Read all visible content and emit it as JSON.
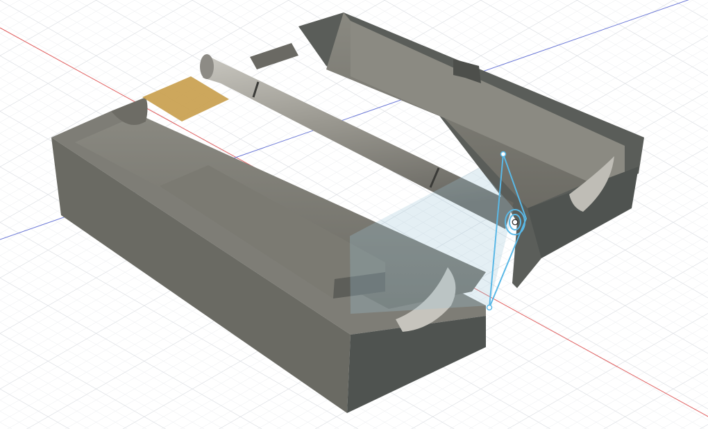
{
  "app": {
    "name": "3D CAD viewport",
    "view": "isometric"
  },
  "viewport": {
    "background": "#ffffff",
    "grid_minor_color": "#e9ebee",
    "grid_major_color": "#d6d9de",
    "axis_x_color": "#e06060",
    "axis_y_color": "#6b78d6"
  },
  "model": {
    "body_color": "#7b7a72",
    "dark_wall_color": "#4f5350",
    "highlight_face_color": "#c9a04e",
    "rod_color": "#a09e97",
    "joint_gizmo_color": "#5ab8e6"
  }
}
